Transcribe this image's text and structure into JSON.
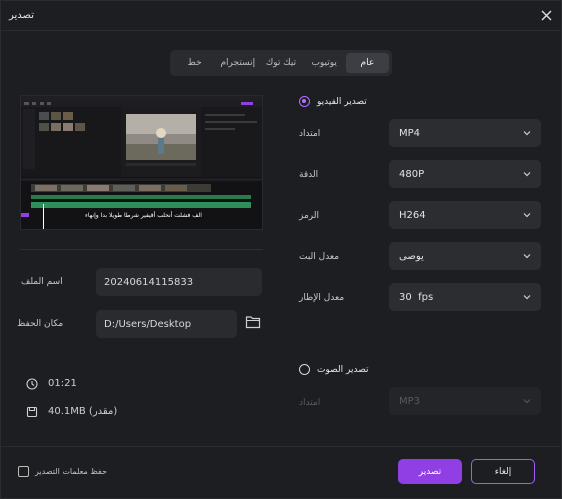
{
  "window": {
    "title": "تصدير"
  },
  "tabs": [
    {
      "label": "عام",
      "active": true
    },
    {
      "label": "يوتيوب",
      "active": false
    },
    {
      "label": "تيك توك",
      "active": false
    },
    {
      "label": "إنستجرام",
      "active": false
    },
    {
      "label": "خط",
      "active": false
    }
  ],
  "preview": {
    "caption": "الف فشلت أنحلب أقيفير شرطا طويلا بدا وإنهاء"
  },
  "file": {
    "name_label": "اسم الملف",
    "name_value": "20240614115833",
    "location_label": "مكان الحفظ",
    "location_value": "D:/Users/Desktop"
  },
  "meta": {
    "duration": "01:21",
    "size": "40.1MB (مقدر)"
  },
  "video_export": {
    "label": "تصدير الفيديو",
    "checked": true,
    "rows": [
      {
        "label": "امتداد",
        "value": "MP4"
      },
      {
        "label": "الدقة",
        "value": "480P"
      },
      {
        "label": "الرمز",
        "value": "H264"
      },
      {
        "label": "معدل البت",
        "value": "يوصى"
      },
      {
        "label": "معدل الإطار",
        "value": "30  fps"
      }
    ]
  },
  "audio_export": {
    "label": "تصدير الصوت",
    "checked": false,
    "rows": [
      {
        "label": "امتداد",
        "value": "MP3"
      }
    ]
  },
  "footer": {
    "save_settings_label": "حفظ معلمات التصدير",
    "export_label": "تصدير",
    "cancel_label": "إلغاء"
  },
  "colors": {
    "accent": "#8f3fe4",
    "background": "#1d1e21",
    "field": "#2c2d31"
  }
}
